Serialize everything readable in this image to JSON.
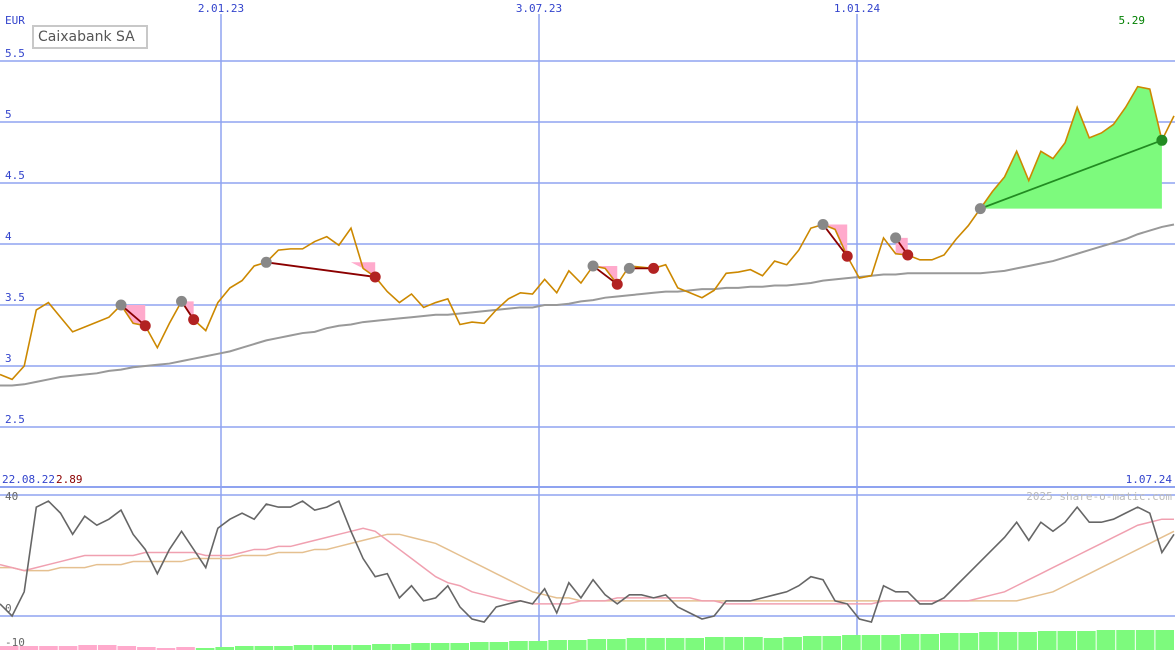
{
  "title": "Caixabank SA",
  "currency": "EUR",
  "watermark": "2025 share-o-matic.com",
  "start_date": "22.08.22",
  "start_value": "2.89",
  "end_date": "1.07.24",
  "last_value": "5.29",
  "colors": {
    "grid": "#8fa3f0",
    "axis_text": "#3344cc",
    "price": "#cc8800",
    "ma": "#999999",
    "gain": "#7dfa7d",
    "loss": "#ffaacc",
    "up_dot": "#228b22",
    "down_dot": "#b22222",
    "signal_dot": "#888888",
    "osc": "#666666",
    "osc_pink": "#f0a0b0",
    "osc_tan": "#e5c090",
    "last_value": "#008000",
    "start_value": "#8b0000"
  },
  "chart_data": [
    {
      "type": "line",
      "title": "Caixabank SA",
      "ylabel": "EUR",
      "ylim": [
        2.3,
        5.6
      ],
      "yticks": [
        "2.5",
        "3",
        "3.5",
        "4",
        "4.5",
        "5",
        "5.5"
      ],
      "xlabels": [
        "2.01.23",
        "3.07.23",
        "1.01.24"
      ],
      "series": [
        {
          "role": "price",
          "values": [
            2.93,
            2.89,
            3.0,
            3.46,
            3.52,
            3.4,
            3.28,
            3.32,
            3.36,
            3.4,
            3.5,
            3.35,
            3.33,
            3.15,
            3.35,
            3.53,
            3.38,
            3.29,
            3.52,
            3.64,
            3.7,
            3.82,
            3.85,
            3.95,
            3.96,
            3.96,
            4.02,
            4.06,
            3.99,
            4.13,
            3.8,
            3.73,
            3.61,
            3.52,
            3.59,
            3.48,
            3.52,
            3.55,
            3.34,
            3.36,
            3.35,
            3.46,
            3.55,
            3.6,
            3.59,
            3.71,
            3.6,
            3.78,
            3.68,
            3.82,
            3.8,
            3.67,
            3.82,
            3.81,
            3.8,
            3.83,
            3.64,
            3.6,
            3.56,
            3.62,
            3.76,
            3.77,
            3.79,
            3.74,
            3.86,
            3.83,
            3.95,
            4.13,
            4.16,
            4.12,
            3.9,
            3.72,
            3.74,
            4.05,
            3.92,
            3.91,
            3.87,
            3.87,
            3.91,
            4.04,
            4.15,
            4.29,
            4.43,
            4.55,
            4.76,
            4.52,
            4.76,
            4.7,
            4.83,
            5.12,
            4.87,
            4.91,
            4.98,
            5.12,
            5.29,
            5.27,
            4.85,
            5.05
          ]
        },
        {
          "role": "moving-average",
          "values": [
            2.84,
            2.84,
            2.85,
            2.87,
            2.89,
            2.91,
            2.92,
            2.93,
            2.94,
            2.96,
            2.97,
            2.99,
            3.0,
            3.01,
            3.02,
            3.04,
            3.06,
            3.08,
            3.1,
            3.12,
            3.15,
            3.18,
            3.21,
            3.23,
            3.25,
            3.27,
            3.28,
            3.31,
            3.33,
            3.34,
            3.36,
            3.37,
            3.38,
            3.39,
            3.4,
            3.41,
            3.42,
            3.42,
            3.43,
            3.44,
            3.45,
            3.46,
            3.47,
            3.48,
            3.48,
            3.5,
            3.5,
            3.51,
            3.53,
            3.54,
            3.56,
            3.57,
            3.58,
            3.59,
            3.6,
            3.61,
            3.61,
            3.62,
            3.63,
            3.63,
            3.64,
            3.64,
            3.65,
            3.65,
            3.66,
            3.66,
            3.67,
            3.68,
            3.7,
            3.71,
            3.72,
            3.73,
            3.74,
            3.75,
            3.75,
            3.76,
            3.76,
            3.76,
            3.76,
            3.76,
            3.76,
            3.76,
            3.77,
            3.78,
            3.8,
            3.82,
            3.84,
            3.86,
            3.89,
            3.92,
            3.95,
            3.98,
            4.01,
            4.04,
            4.08,
            4.11,
            4.14,
            4.16
          ]
        }
      ],
      "signals": [
        {
          "kind": "loss",
          "from": [
            10,
            3.5
          ],
          "to": [
            12,
            3.33
          ]
        },
        {
          "kind": "loss",
          "from": [
            15,
            3.53
          ],
          "to": [
            16,
            3.38
          ]
        },
        {
          "kind": "loss",
          "from": [
            22,
            3.85
          ],
          "to": [
            31,
            3.73
          ]
        },
        {
          "kind": "loss",
          "from": [
            49,
            3.82
          ],
          "to": [
            51,
            3.67
          ]
        },
        {
          "kind": "loss",
          "from": [
            52,
            3.8
          ],
          "to": [
            54,
            3.8
          ]
        },
        {
          "kind": "loss",
          "from": [
            68,
            4.16
          ],
          "to": [
            70,
            3.9
          ]
        },
        {
          "kind": "loss",
          "from": [
            74,
            4.05
          ],
          "to": [
            75,
            3.91
          ]
        },
        {
          "kind": "gain",
          "from": [
            81,
            4.29
          ],
          "to": [
            96,
            4.85
          ]
        }
      ]
    },
    {
      "type": "line",
      "ylim": [
        -10,
        40
      ],
      "yticks": [
        "40",
        "0",
        "-10"
      ],
      "series": [
        {
          "role": "oscillator",
          "values": [
            4,
            0,
            8,
            36,
            38,
            34,
            27,
            33,
            30,
            32,
            35,
            27,
            22,
            14,
            22,
            28,
            22,
            16,
            29,
            32,
            34,
            32,
            37,
            36,
            36,
            38,
            35,
            36,
            38,
            28,
            19,
            13,
            14,
            6,
            10,
            5,
            6,
            10,
            3,
            -1,
            -2,
            3,
            4,
            5,
            4,
            9,
            1,
            11,
            6,
            12,
            7,
            4,
            7,
            7,
            6,
            7,
            3,
            1,
            -1,
            0,
            5,
            5,
            5,
            6,
            7,
            8,
            10,
            13,
            12,
            5,
            4,
            -1,
            -2,
            10,
            8,
            8,
            4,
            4,
            6,
            10,
            14,
            18,
            22,
            26,
            31,
            25,
            31,
            28,
            31,
            36,
            31,
            31,
            32,
            34,
            36,
            34,
            21,
            27
          ]
        },
        {
          "role": "signal-pink",
          "values": [
            17,
            16,
            15,
            16,
            17,
            18,
            19,
            20,
            20,
            20,
            20,
            20,
            21,
            21,
            21,
            21,
            21,
            20,
            20,
            20,
            21,
            22,
            22,
            23,
            23,
            24,
            25,
            26,
            27,
            28,
            29,
            28,
            25,
            22,
            19,
            16,
            13,
            11,
            10,
            8,
            7,
            6,
            5,
            5,
            4,
            4,
            4,
            4,
            5,
            5,
            5,
            6,
            6,
            6,
            6,
            6,
            6,
            6,
            5,
            5,
            4,
            4,
            4,
            4,
            4,
            4,
            4,
            4,
            4,
            4,
            4,
            4,
            4,
            5,
            5,
            5,
            5,
            5,
            5,
            5,
            5,
            6,
            7,
            8,
            10,
            12,
            14,
            16,
            18,
            20,
            22,
            24,
            26,
            28,
            30,
            31,
            32,
            32
          ]
        },
        {
          "role": "signal-tan",
          "values": [
            16,
            16,
            15,
            15,
            15,
            16,
            16,
            16,
            17,
            17,
            17,
            18,
            18,
            18,
            18,
            18,
            19,
            19,
            19,
            19,
            20,
            20,
            20,
            21,
            21,
            21,
            22,
            22,
            23,
            24,
            25,
            26,
            27,
            27,
            26,
            25,
            24,
            22,
            20,
            18,
            16,
            14,
            12,
            10,
            8,
            7,
            6,
            6,
            5,
            5,
            5,
            5,
            5,
            5,
            5,
            5,
            5,
            5,
            5,
            5,
            5,
            5,
            5,
            5,
            5,
            5,
            5,
            5,
            5,
            5,
            5,
            5,
            5,
            5,
            5,
            5,
            5,
            5,
            5,
            5,
            5,
            5,
            5,
            5,
            5,
            6,
            7,
            8,
            10,
            12,
            14,
            16,
            18,
            20,
            22,
            24,
            26,
            28
          ]
        }
      ]
    }
  ]
}
